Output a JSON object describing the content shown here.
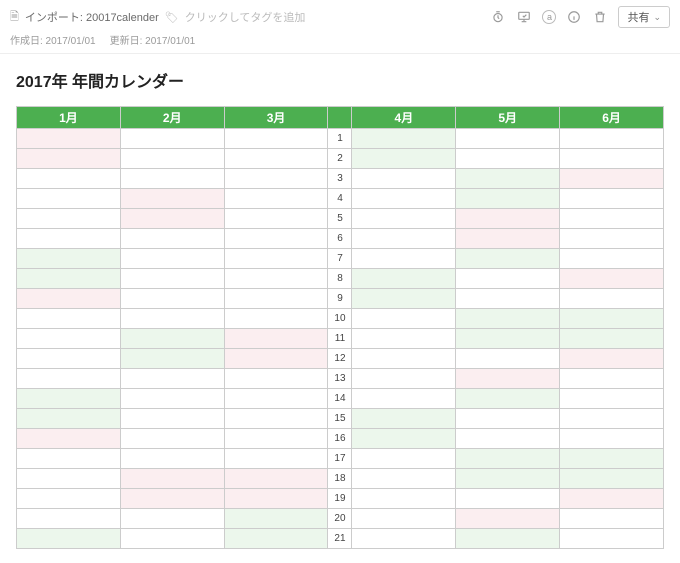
{
  "topbar": {
    "import_label": "インポート: 20017calender",
    "tag_hint": "クリックしてタグを追加",
    "share_label": "共有"
  },
  "dates": {
    "created_label": "作成日: 2017/01/01",
    "updated_label": "更新日: 2017/01/01"
  },
  "title": "2017年 年間カレンダー",
  "months": [
    "1月",
    "2月",
    "3月",
    "4月",
    "5月",
    "6月"
  ],
  "days": [
    "1",
    "2",
    "3",
    "4",
    "5",
    "6",
    "7",
    "8",
    "9",
    "10",
    "11",
    "12",
    "13",
    "14",
    "15",
    "16",
    "17",
    "18",
    "19",
    "20",
    "21"
  ],
  "shading": {
    "1": [
      "pink",
      "",
      "",
      "green",
      "",
      ""
    ],
    "2": [
      "pink",
      "",
      "",
      "green",
      "",
      ""
    ],
    "3": [
      "",
      "",
      "",
      "",
      "green",
      "pink"
    ],
    "4": [
      "",
      "pink",
      "",
      "",
      "green",
      ""
    ],
    "5": [
      "",
      "pink",
      "",
      "",
      "pink",
      ""
    ],
    "6": [
      "",
      "",
      "",
      "",
      "pink",
      ""
    ],
    "7": [
      "green",
      "",
      "",
      "",
      "green",
      ""
    ],
    "8": [
      "green",
      "",
      "",
      "green",
      "",
      "pink"
    ],
    "9": [
      "pink",
      "",
      "",
      "green",
      "",
      ""
    ],
    "10": [
      "",
      "",
      "",
      "",
      "green",
      "green"
    ],
    "11": [
      "",
      "green",
      "pink",
      "",
      "green",
      "green"
    ],
    "12": [
      "",
      "green",
      "pink",
      "",
      "",
      "pink"
    ],
    "13": [
      "",
      "",
      "",
      "",
      "pink",
      ""
    ],
    "14": [
      "green",
      "",
      "",
      "",
      "green",
      ""
    ],
    "15": [
      "green",
      "",
      "",
      "green",
      "",
      ""
    ],
    "16": [
      "pink",
      "",
      "",
      "green",
      "",
      ""
    ],
    "17": [
      "",
      "",
      "",
      "",
      "green",
      "green"
    ],
    "18": [
      "",
      "pink",
      "pink",
      "",
      "green",
      "green"
    ],
    "19": [
      "",
      "pink",
      "pink",
      "",
      "",
      "pink"
    ],
    "20": [
      "",
      "",
      "green",
      "",
      "pink",
      ""
    ],
    "21": [
      "green",
      "",
      "green",
      "",
      "green",
      ""
    ]
  }
}
